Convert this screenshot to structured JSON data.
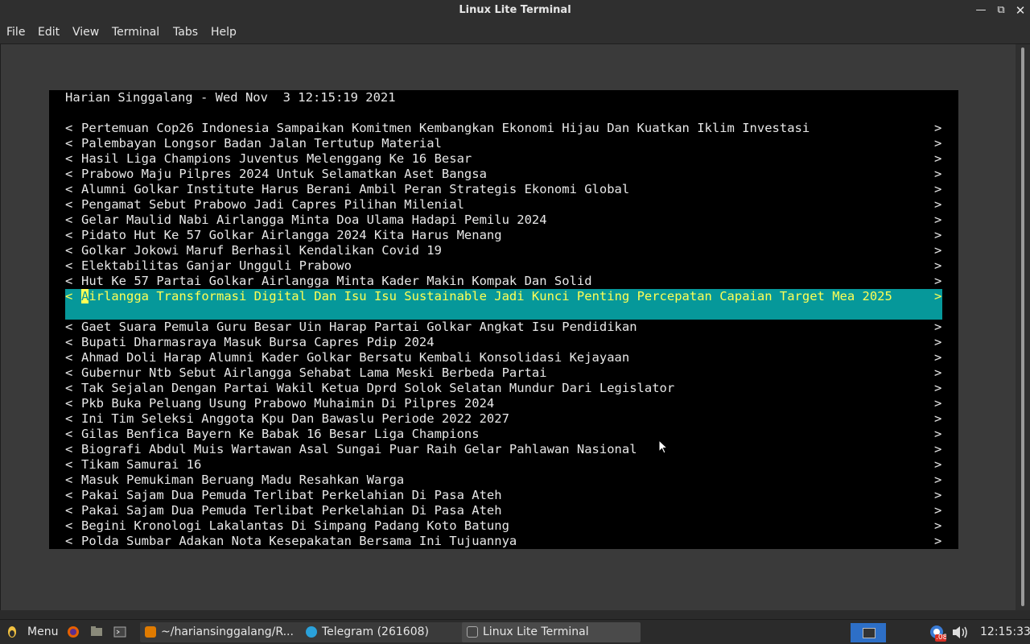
{
  "window": {
    "title": "Linux Lite Terminal"
  },
  "menu": [
    "File",
    "Edit",
    "View",
    "Terminal",
    "Tabs",
    "Help"
  ],
  "screen": {
    "header": "Harian Singgalang - Wed Nov  3 12:15:19 2021",
    "items": [
      "Pertemuan Cop26 Indonesia Sampaikan Komitmen Kembangkan Ekonomi Hijau Dan Kuatkan Iklim Investasi",
      "Palembayan Longsor Badan Jalan Tertutup Material",
      "Hasil Liga Champions Juventus Melenggang Ke 16 Besar",
      "Prabowo Maju Pilpres 2024 Untuk Selamatkan Aset Bangsa",
      "Alumni Golkar Institute Harus Berani Ambil Peran Strategis Ekonomi Global",
      "Pengamat Sebut Prabowo Jadi Capres Pilihan Milenial",
      "Gelar Maulid Nabi Airlangga Minta Doa Ulama Hadapi Pemilu 2024",
      "Pidato Hut Ke 57 Golkar Airlangga 2024 Kita Harus Menang",
      "Golkar Jokowi Maruf Berhasil Kendalikan Covid 19",
      "Elektabilitas Ganjar Ungguli Prabowo",
      "Hut Ke 57 Partai Golkar Airlangga Minta Kader Makin Kompak Dan Solid"
    ],
    "selected": {
      "first_char": "A",
      "rest": "irlangga Transformasi Digital Dan Isu Isu Sustainable Jadi Kunci Penting Percepatan Capaian Target Mea 2025"
    },
    "items_after": [
      "Gaet Suara Pemula Guru Besar Uin Harap Partai Golkar Angkat Isu Pendidikan",
      "Bupati Dharmasraya Masuk Bursa Capres Pdip 2024",
      "Ahmad Doli Harap Alumni Kader Golkar Bersatu Kembali Konsolidasi Kejayaan",
      "Gubernur Ntb Sebut Airlangga Sehabat Lama Meski Berbeda Partai",
      "Tak Sejalan Dengan Partai Wakil Ketua Dprd Solok Selatan Mundur Dari Legislator",
      "Pkb Buka Peluang Usung Prabowo Muhaimin Di Pilpres 2024",
      "Ini Tim Seleksi Anggota Kpu Dan Bawaslu Periode 2022 2027",
      "Gilas Benfica Bayern Ke Babak 16 Besar Liga Champions",
      "Biografi Abdul Muis Wartawan Asal Sungai Puar Raih Gelar Pahlawan Nasional",
      "Tikam Samurai 16",
      "Masuk Pemukiman Beruang Madu Resahkan Warga",
      "Pakai Sajam Dua Pemuda Terlibat Perkelahian Di Pasa Ateh",
      "Pakai Sajam Dua Pemuda Terlibat Perkelahian Di Pasa Ateh",
      "Begini Kronologi Lakalantas Di Simpang Padang Koto Batung",
      "Polda Sumbar Adakan Nota Kesepakatan Bersama Ini Tujuannya"
    ],
    "left_marker": "<",
    "right_marker": ">"
  },
  "taskbar": {
    "menu_label": "Menu",
    "tasks": [
      "~/hariansinggalang/R...",
      "Telegram (261608)",
      "Linux Lite Terminal"
    ],
    "clock": "12:15:33",
    "badge": ".08"
  },
  "colors": {
    "selection_bg": "#06989a",
    "selection_fg": "#ffff55",
    "terminal_bg": "#000000"
  }
}
